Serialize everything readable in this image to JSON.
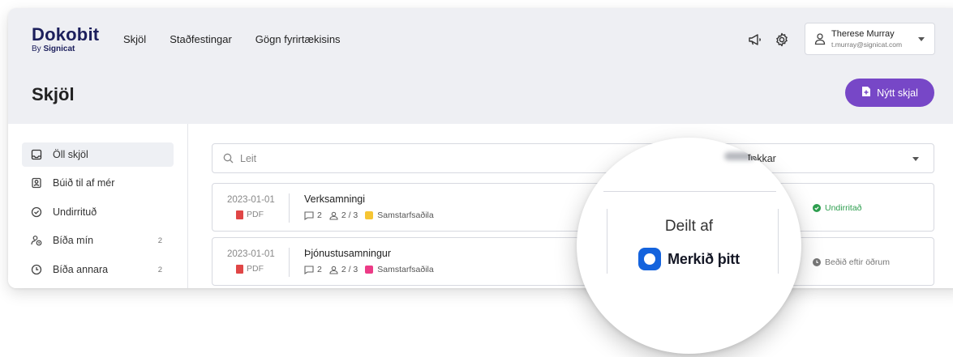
{
  "brand": {
    "name": "Dokobit",
    "by": "By",
    "by_brand": "Signicat"
  },
  "nav": {
    "items": [
      {
        "label": "Skjöl"
      },
      {
        "label": "Staðfestingar"
      },
      {
        "label": "Gögn fyrirtækisins"
      }
    ]
  },
  "user": {
    "name": "Therese Murray",
    "email": "t.murray@signicat.com"
  },
  "page": {
    "title": "Skjöl",
    "new_button": "Nýtt skjal"
  },
  "sidebar": {
    "items": [
      {
        "label": "Öll skjöl",
        "count": ""
      },
      {
        "label": "Búið til af mér",
        "count": ""
      },
      {
        "label": "Undirrituð",
        "count": ""
      },
      {
        "label": "Bíða mín",
        "count": "2"
      },
      {
        "label": "Bíða annara",
        "count": "2"
      }
    ]
  },
  "search": {
    "placeholder": "Leit",
    "filter_label": "flokkar"
  },
  "documents": [
    {
      "date": "2023-01-01",
      "type": "PDF",
      "title": "Verksamningi",
      "comments": "2",
      "signers": "2 / 3",
      "tag": "Samstarfsaðila",
      "tag_color": "#f6c533",
      "status": "Undirritað",
      "status_color": "#2e9e4f"
    },
    {
      "date": "2023-01-01",
      "type": "PDF",
      "title": "Þjónustusamningur",
      "comments": "2",
      "signers": "2 / 3",
      "tag": "Samstarfsaðila",
      "tag_color": "#ec3b86",
      "status": "Beðið eftir öðrum",
      "status_color": "#777777"
    }
  ],
  "magnifier": {
    "label": "Deilt af",
    "brand": "Merkið þitt",
    "filter": "flokkar"
  },
  "colors": {
    "accent": "#7747c7",
    "brand_blue": "#1463dd",
    "logo_navy": "#1c1f5c"
  }
}
